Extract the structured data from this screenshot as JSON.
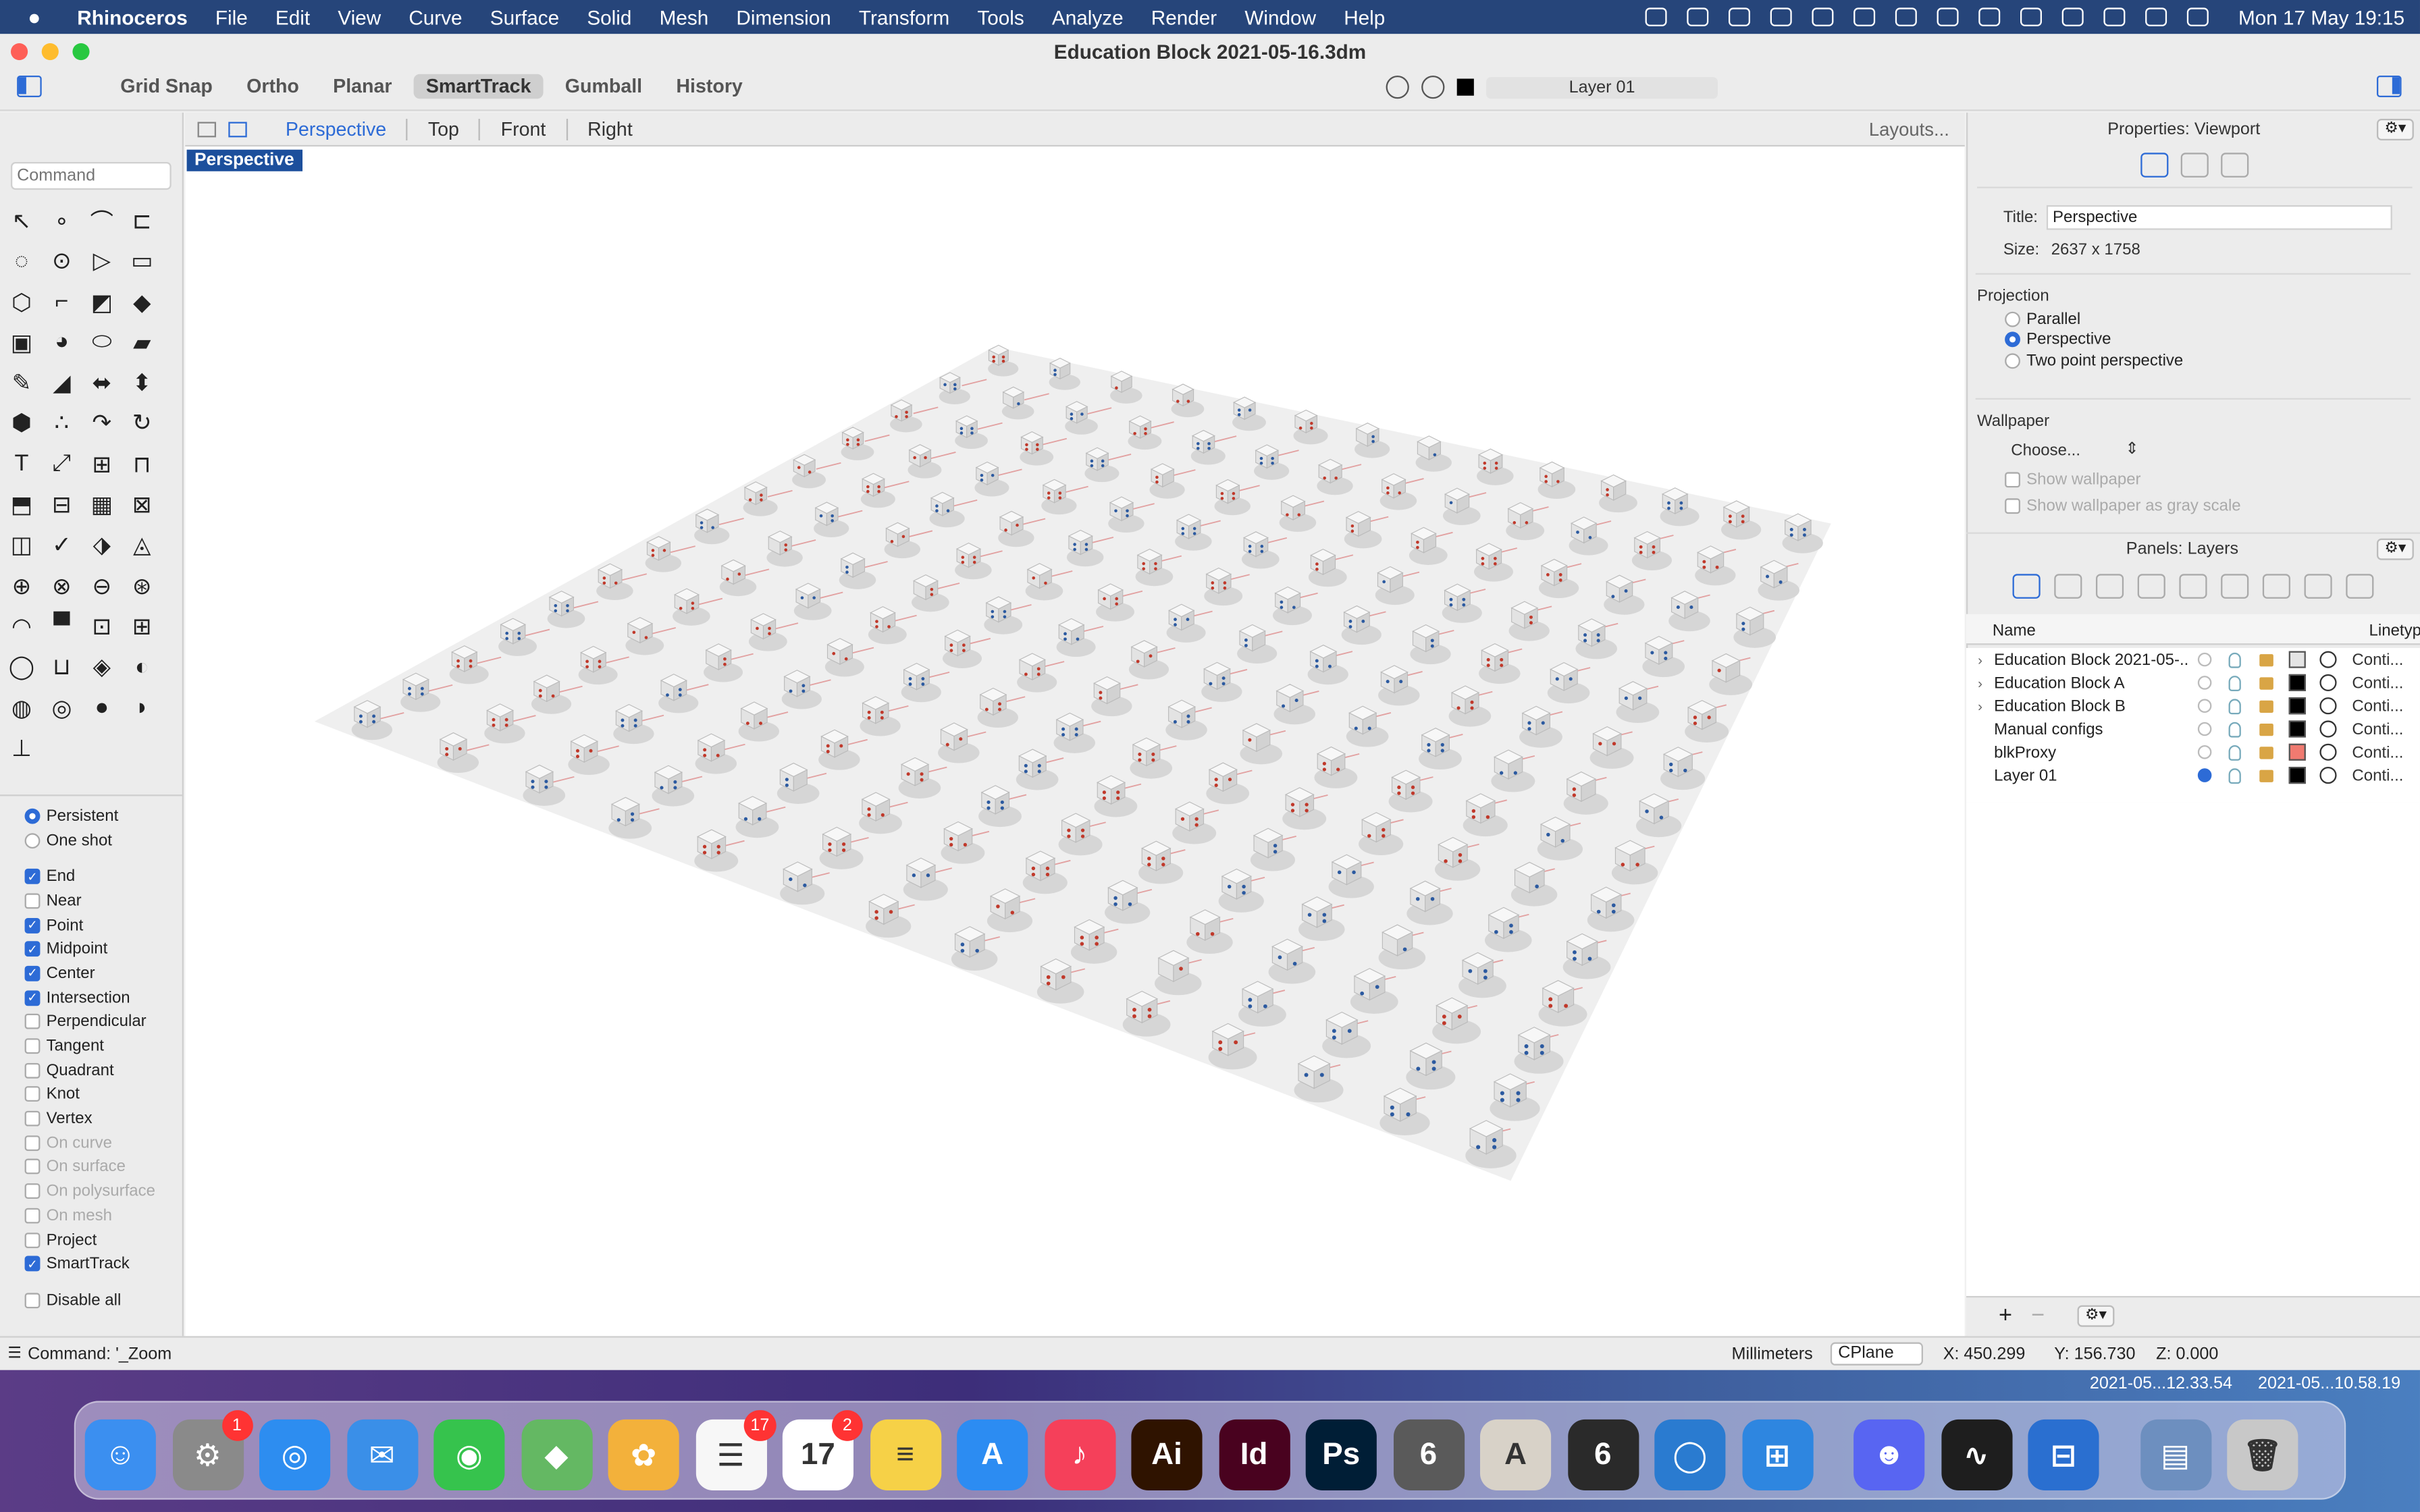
{
  "menubar": {
    "app": "Rhinoceros",
    "items": [
      "File",
      "Edit",
      "View",
      "Curve",
      "Surface",
      "Solid",
      "Mesh",
      "Dimension",
      "Transform",
      "Tools",
      "Analyze",
      "Render",
      "Window",
      "Help"
    ],
    "clock": "Mon 17 May  19:15"
  },
  "window": {
    "title": "Education Block 2021-05-16.3dm"
  },
  "modes": [
    {
      "label": "Grid Snap",
      "active": false
    },
    {
      "label": "Ortho",
      "active": false
    },
    {
      "label": "Planar",
      "active": false
    },
    {
      "label": "SmartTrack",
      "active": true
    },
    {
      "label": "Gumball",
      "active": false
    },
    {
      "label": "History",
      "active": false
    }
  ],
  "current_layer": "Layer 01",
  "command": {
    "placeholder": "Command"
  },
  "osnap": {
    "mode_options": [
      {
        "label": "Persistent",
        "on": true
      },
      {
        "label": "One shot",
        "on": false
      }
    ],
    "items": [
      {
        "label": "End",
        "on": true,
        "enabled": true
      },
      {
        "label": "Near",
        "on": false,
        "enabled": true
      },
      {
        "label": "Point",
        "on": true,
        "enabled": true
      },
      {
        "label": "Midpoint",
        "on": true,
        "enabled": true
      },
      {
        "label": "Center",
        "on": true,
        "enabled": true
      },
      {
        "label": "Intersection",
        "on": true,
        "enabled": true
      },
      {
        "label": "Perpendicular",
        "on": false,
        "enabled": true
      },
      {
        "label": "Tangent",
        "on": false,
        "enabled": true
      },
      {
        "label": "Quadrant",
        "on": false,
        "enabled": true
      },
      {
        "label": "Knot",
        "on": false,
        "enabled": true
      },
      {
        "label": "Vertex",
        "on": false,
        "enabled": true
      },
      {
        "label": "On curve",
        "on": false,
        "enabled": false
      },
      {
        "label": "On surface",
        "on": false,
        "enabled": false
      },
      {
        "label": "On polysurface",
        "on": false,
        "enabled": false
      },
      {
        "label": "On mesh",
        "on": false,
        "enabled": false
      },
      {
        "label": "Project",
        "on": false,
        "enabled": true
      },
      {
        "label": "SmartTrack",
        "on": true,
        "enabled": true
      }
    ],
    "disable_all": "Disable all"
  },
  "viewport_tabs": [
    "Perspective",
    "Top",
    "Front",
    "Right"
  ],
  "layouts_label": "Layouts...",
  "viewport_label": "Perspective",
  "properties": {
    "panel_title": "Properties: Viewport",
    "title_label": "Title:",
    "title_value": "Perspective",
    "size_label": "Size:",
    "size_value": "2637 x 1758",
    "projection_heading": "Projection",
    "projection_options": [
      {
        "label": "Parallel",
        "on": false
      },
      {
        "label": "Perspective",
        "on": true
      },
      {
        "label": "Two point perspective",
        "on": false
      }
    ],
    "wallpaper_heading": "Wallpaper",
    "wallpaper_choose": "Choose...",
    "show_wallpaper": "Show wallpaper",
    "show_gray": "Show wallpaper as gray scale"
  },
  "layers": {
    "panel_title": "Panels: Layers",
    "col_name": "Name",
    "col_linetype": "Linetyp",
    "rows": [
      {
        "name": "Education Block 2021-05-...",
        "expand": true,
        "current": false,
        "color": "#e4e4e4",
        "linetype": "Conti..."
      },
      {
        "name": "Education Block A",
        "expand": true,
        "current": false,
        "color": "#000000",
        "linetype": "Conti..."
      },
      {
        "name": "Education Block B",
        "expand": true,
        "current": false,
        "color": "#000000",
        "linetype": "Conti..."
      },
      {
        "name": "Manual configs",
        "expand": false,
        "current": false,
        "color": "#000000",
        "linetype": "Conti..."
      },
      {
        "name": "blkProxy",
        "expand": false,
        "current": false,
        "color": "#f07a70",
        "linetype": "Conti..."
      },
      {
        "name": "Layer 01",
        "expand": false,
        "current": true,
        "color": "#000000",
        "linetype": "Conti..."
      }
    ]
  },
  "status": {
    "command": "Command: '_Zoom",
    "units": "Millimeters",
    "cplane": "CPlane",
    "x": "X: 450.299",
    "y": "Y: 156.730",
    "z": "Z: 0.000"
  },
  "desktop_files": [
    "2021-05...12.33.54",
    "2021-05...10.58.19"
  ],
  "dock": [
    {
      "name": "Finder",
      "color": "#3b8ff0",
      "glyph": "☺"
    },
    {
      "name": "System Preferences",
      "color": "#8a8a8a",
      "glyph": "⚙",
      "badge": "1"
    },
    {
      "name": "Safari",
      "color": "#2d8df0",
      "glyph": "◎"
    },
    {
      "name": "Mail",
      "color": "#3a8fe8",
      "glyph": "✉"
    },
    {
      "name": "Messages",
      "color": "#36c34d",
      "glyph": "◉"
    },
    {
      "name": "Maps",
      "color": "#64b863",
      "glyph": "◆"
    },
    {
      "name": "Photos",
      "color": "#f3b13b",
      "glyph": "✿"
    },
    {
      "name": "Reminders",
      "color": "#f7f7f7",
      "glyph": "☰",
      "badge": "17"
    },
    {
      "name": "Calendar",
      "color": "#ffffff",
      "glyph": "17",
      "badge": "2"
    },
    {
      "name": "Notes",
      "color": "#f6d147",
      "glyph": "≡"
    },
    {
      "name": "App Store",
      "color": "#2c8cf2",
      "glyph": "A"
    },
    {
      "name": "Music",
      "color": "#f5405a",
      "glyph": "♪"
    },
    {
      "name": "Illustrator",
      "color": "#2f1300",
      "glyph": "Ai"
    },
    {
      "name": "InDesign",
      "color": "#49021f",
      "glyph": "Id"
    },
    {
      "name": "Photoshop",
      "color": "#001e36",
      "glyph": "Ps"
    },
    {
      "name": "Rhino 6",
      "color": "#5a5a5a",
      "glyph": "6"
    },
    {
      "name": "Architecture",
      "color": "#d8d2c8",
      "glyph": "A"
    },
    {
      "name": "Rhino 6 WIP",
      "color": "#2a2a2a",
      "glyph": "6"
    },
    {
      "name": "KeyShot",
      "color": "#2a7bd0",
      "glyph": "◯"
    },
    {
      "name": "Windows",
      "color": "#2e86e0",
      "glyph": "⊞"
    },
    {
      "name": "Discord",
      "color": "#5865f2",
      "glyph": "☻"
    },
    {
      "name": "Activity Monitor",
      "color": "#1e1e1e",
      "glyph": "∿"
    },
    {
      "name": "Security",
      "color": "#2a6fd0",
      "glyph": "⊟"
    },
    {
      "name": "Documents",
      "color": "#6d8fbf",
      "glyph": "▤"
    },
    {
      "name": "Trash",
      "color": "#c8c8c8",
      "glyph": "🗑"
    }
  ]
}
